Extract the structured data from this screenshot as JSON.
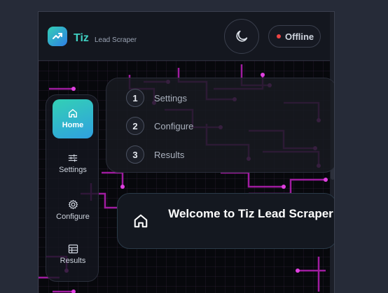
{
  "app": {
    "brand": "Tiz",
    "brand_sub": "Lead Scraper",
    "status": "Offline",
    "status_color": "#ef4444",
    "accent": "#3fd0c2"
  },
  "sidebar": {
    "items": [
      {
        "label": "Home",
        "icon": "home-icon",
        "active": true
      },
      {
        "label": "Settings",
        "icon": "sliders-icon"
      },
      {
        "label": "Configure",
        "icon": "gear-icon"
      },
      {
        "label": "Results",
        "icon": "table-icon"
      }
    ]
  },
  "steps": [
    {
      "num": "1",
      "label": "Settings"
    },
    {
      "num": "2",
      "label": "Configure"
    },
    {
      "num": "3",
      "label": "Results"
    }
  ],
  "welcome": {
    "title": "Welcome to Tiz Lead Scraper",
    "icon": "home-icon"
  }
}
